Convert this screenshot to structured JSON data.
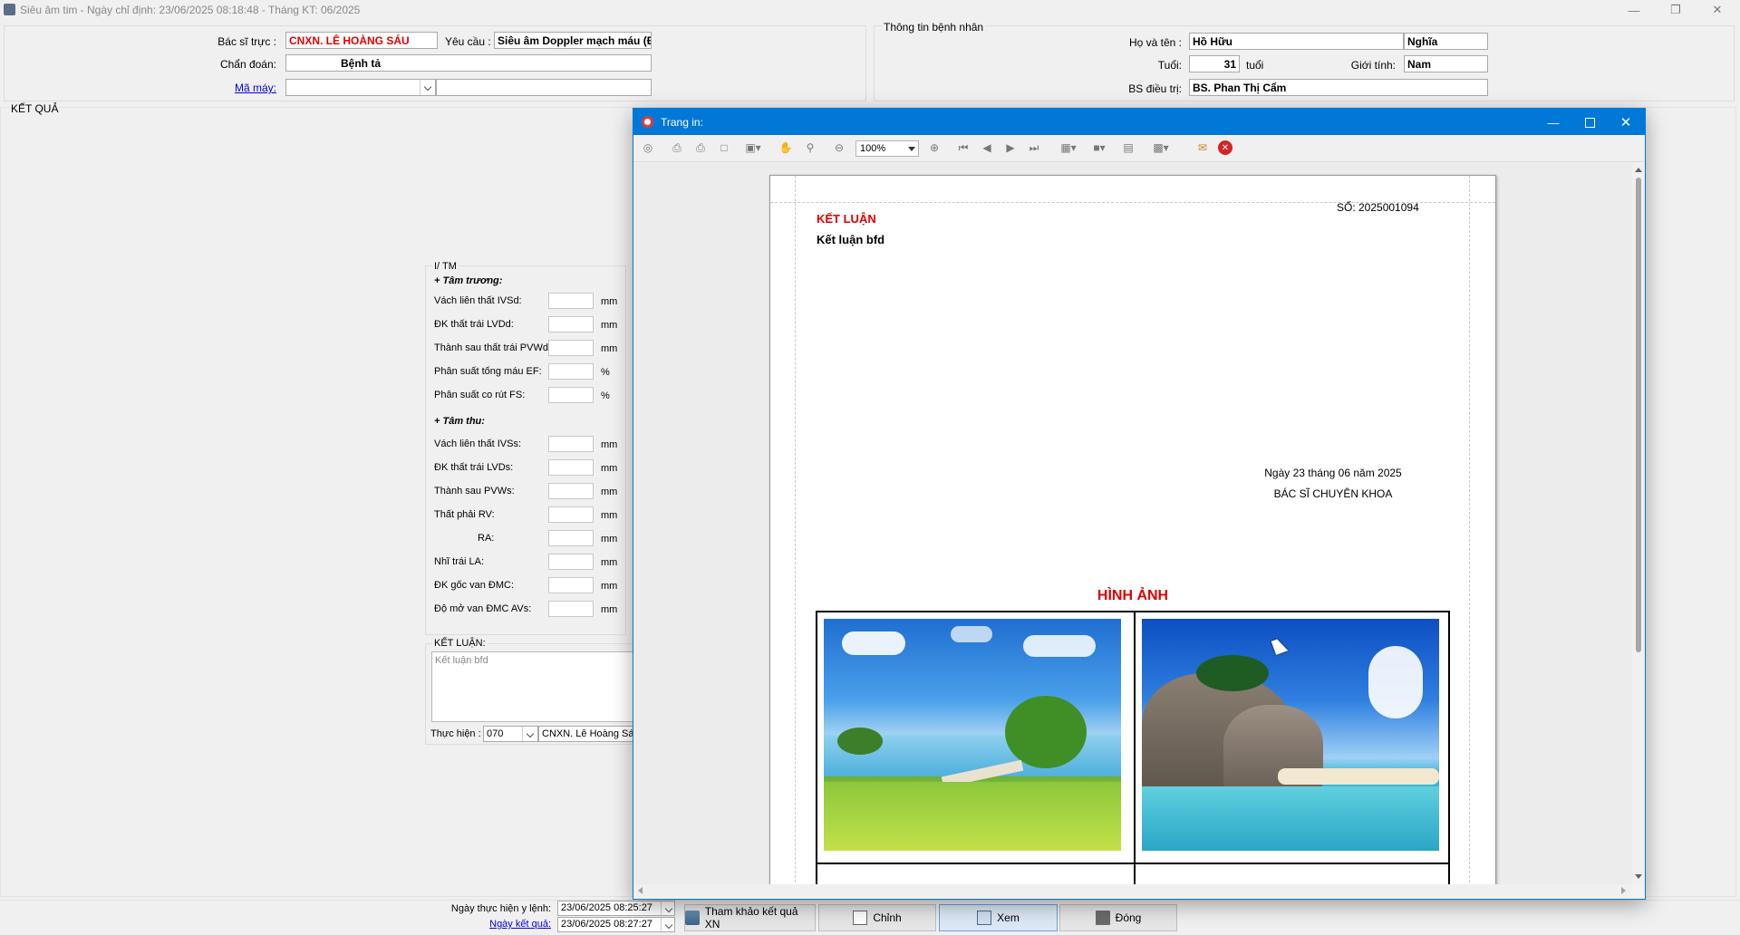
{
  "window": {
    "title": "Siêu âm tim - Ngày chỉ định: 23/06/2025 08:18:48 - Tháng KT: 06/2025"
  },
  "header": {
    "bac_si_truc_label": "Bác sĩ trực :",
    "bac_si_truc_value": "CNXN. LÊ HOÀNG SÁU",
    "yeu_cau_label": "Yêu cầu :",
    "yeu_cau_value": "Siêu âm Doppler mạch máu (Đ",
    "chan_doan_label": "Chẩn đoán:",
    "chan_doan_value": "Bệnh tả",
    "ma_may_label": "Mã máy:",
    "ket_qua_label": "KẾT QUẢ"
  },
  "patient": {
    "group_title": "Thông tin bệnh nhân",
    "ho_ten_label": "Họ và tên :",
    "ho_ten_value": "Hồ Hữu",
    "ten_value": "Nghĩa",
    "tuoi_label": "Tuổi:",
    "tuoi_value": "31",
    "tuoi_unit": "tuổi",
    "gioi_tinh_label": "Giới tính:",
    "gioi_tinh_value": "Nam",
    "bs_dieu_tri_label": "BS điều trị:",
    "bs_dieu_tri_value": "BS. Phan Thị Cẩm"
  },
  "measurements": {
    "group_title": "I/ TM",
    "tam_truong_title": "+ Tâm trương:",
    "tam_truong": [
      {
        "label": "Vách liên thất IVSd:",
        "unit": "mm"
      },
      {
        "label": "ĐK thất trái LVDd:",
        "unit": "mm"
      },
      {
        "label": "Thành sau thất trái PVWd:",
        "unit": "mm"
      },
      {
        "label": "Phân suất tống máu EF:",
        "unit": "%"
      },
      {
        "label": "Phân suất co rút FS:",
        "unit": "%"
      }
    ],
    "tam_thu_title": "+ Tâm thu:",
    "tam_thu": [
      {
        "label": "Vách liên thất IVSs:",
        "unit": "mm"
      },
      {
        "label": "ĐK thất trái LVDs:",
        "unit": "mm"
      },
      {
        "label": "Thành sau PVWs:",
        "unit": "mm"
      },
      {
        "label": "Thất phải RV:",
        "unit": "mm"
      },
      {
        "label": "RA:",
        "unit": "mm"
      },
      {
        "label": "Nhĩ trái LA:",
        "unit": "mm"
      },
      {
        "label": "ĐK gốc van ĐMC:",
        "unit": "mm"
      },
      {
        "label": "Độ mở van ĐMC AVs:",
        "unit": "mm"
      }
    ]
  },
  "ket_luan": {
    "group_title": "KẾT LUẬN:",
    "text": "Kết luận bfd",
    "thuc_hien_label": "Thực hiện :",
    "thuc_hien_code": "070",
    "thuc_hien_name": "CNXN. Lê Hoàng Sáu"
  },
  "footer": {
    "ngay_thuc_hien_label": "Ngày thực hiện y lệnh:",
    "ngay_thuc_hien_value": "23/06/2025 08:25:27",
    "ngay_ket_qua_label": "Ngày kết quả:",
    "ngay_ket_qua_value": "23/06/2025 08:27:27",
    "btn_tham_khao": "Tham khảo kết quả XN",
    "btn_chinh": "Chỉnh",
    "btn_xem": "Xem",
    "btn_dong": "Đóng"
  },
  "print_dialog": {
    "title": "Trang in:",
    "zoom": "100%",
    "report": {
      "so": "SỐ: 2025001094",
      "ket_luan_title": "KẾT LUẬN",
      "ket_luan_text": "Kết luận bfd",
      "date_line": "Ngày 23 tháng 06 năm 2025",
      "signer_title": "BÁC SĨ CHUYÊN KHOA",
      "hinh_anh_title": "HÌNH ẢNH"
    }
  },
  "colors": {
    "accent_blue": "#0078d7",
    "title_red": "#e00000",
    "toolbar_bg": "#f0f0f0"
  }
}
